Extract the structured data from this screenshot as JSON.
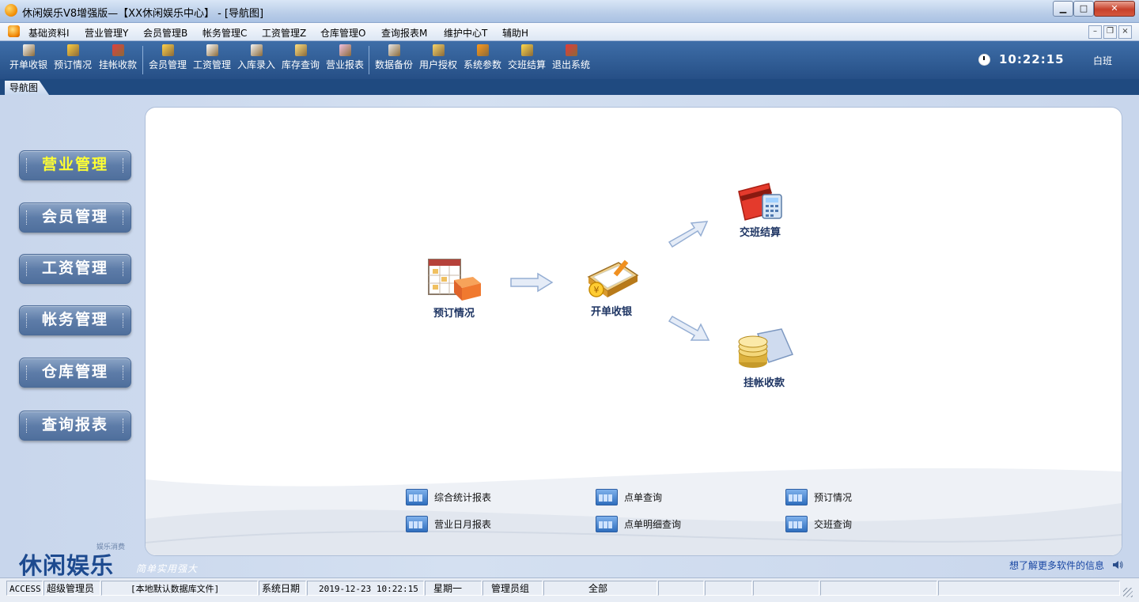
{
  "window": {
    "title": "休闲娱乐V8增强版—【XX休闲娱乐中心】 - [导航图]",
    "min_label": "▁",
    "max_label": "□",
    "close_label": "✕"
  },
  "menu": {
    "items": [
      "基础资料I",
      "营业管理Y",
      "会员管理B",
      "帐务管理C",
      "工资管理Z",
      "仓库管理O",
      "查询报表M",
      "维护中心T",
      "辅助H"
    ],
    "mdi_min": "–",
    "mdi_restore": "❐",
    "mdi_close": "×"
  },
  "toolbar": {
    "buttons": [
      {
        "label": "开单收银",
        "icon": "open-bill-icon",
        "color": "#f6f6f6"
      },
      {
        "label": "预订情况",
        "icon": "reservation-icon",
        "color": "#ffcf40"
      },
      {
        "label": "挂帐收款",
        "icon": "credit-collect-icon",
        "color": "#e04040"
      },
      {
        "label": "会员管理",
        "icon": "member-icon",
        "color": "#ffd24a"
      },
      {
        "label": "工资管理",
        "icon": "salary-icon",
        "color": "#ffffff"
      },
      {
        "label": "入库录入",
        "icon": "stock-in-icon",
        "color": "#f3f3f3"
      },
      {
        "label": "库存查询",
        "icon": "stock-query-icon",
        "color": "#ffe080"
      },
      {
        "label": "营业报表",
        "icon": "business-report-icon",
        "color": "#f0c0e0"
      },
      {
        "label": "数据备份",
        "icon": "backup-icon",
        "color": "#e8e8e8"
      },
      {
        "label": "用户授权",
        "icon": "user-auth-icon",
        "color": "#f6d46a"
      },
      {
        "label": "系统参数",
        "icon": "system-params-icon",
        "color": "#ff9a1a"
      },
      {
        "label": "交班结算",
        "icon": "shift-settle-icon",
        "color": "#ffd84a"
      },
      {
        "label": "退出系统",
        "icon": "exit-icon",
        "color": "#e23a3a"
      }
    ],
    "time": "10:22:15",
    "shift": "白班"
  },
  "tabs": {
    "active": "导航图"
  },
  "sidebar": {
    "items": [
      "营业管理",
      "会员管理",
      "工资管理",
      "帐务管理",
      "仓库管理",
      "查询报表"
    ],
    "active_color": "#ffff33"
  },
  "flow": {
    "reservation": "预订情况",
    "open_bill": "开单收银",
    "shift_settle": "交班结算",
    "credit_collect": "挂帐收款"
  },
  "quick_links": [
    "综合统计报表",
    "点单查询",
    "预订情况",
    "营业日月报表",
    "点单明细查询",
    "交班查询"
  ],
  "brand": {
    "big": "休闲娱乐",
    "small": "娱乐消费",
    "slogan": "简单实用强大"
  },
  "more_info": "想了解更多软件的信息",
  "status": {
    "db": "ACCESS",
    "user": "超级管理员",
    "dbfile": "[本地默认数据库文件]",
    "date_label": "系统日期",
    "datetime": "2019-12-23  10:22:15",
    "weekday": "星期一",
    "group": "管理员组",
    "scope": "全部"
  }
}
